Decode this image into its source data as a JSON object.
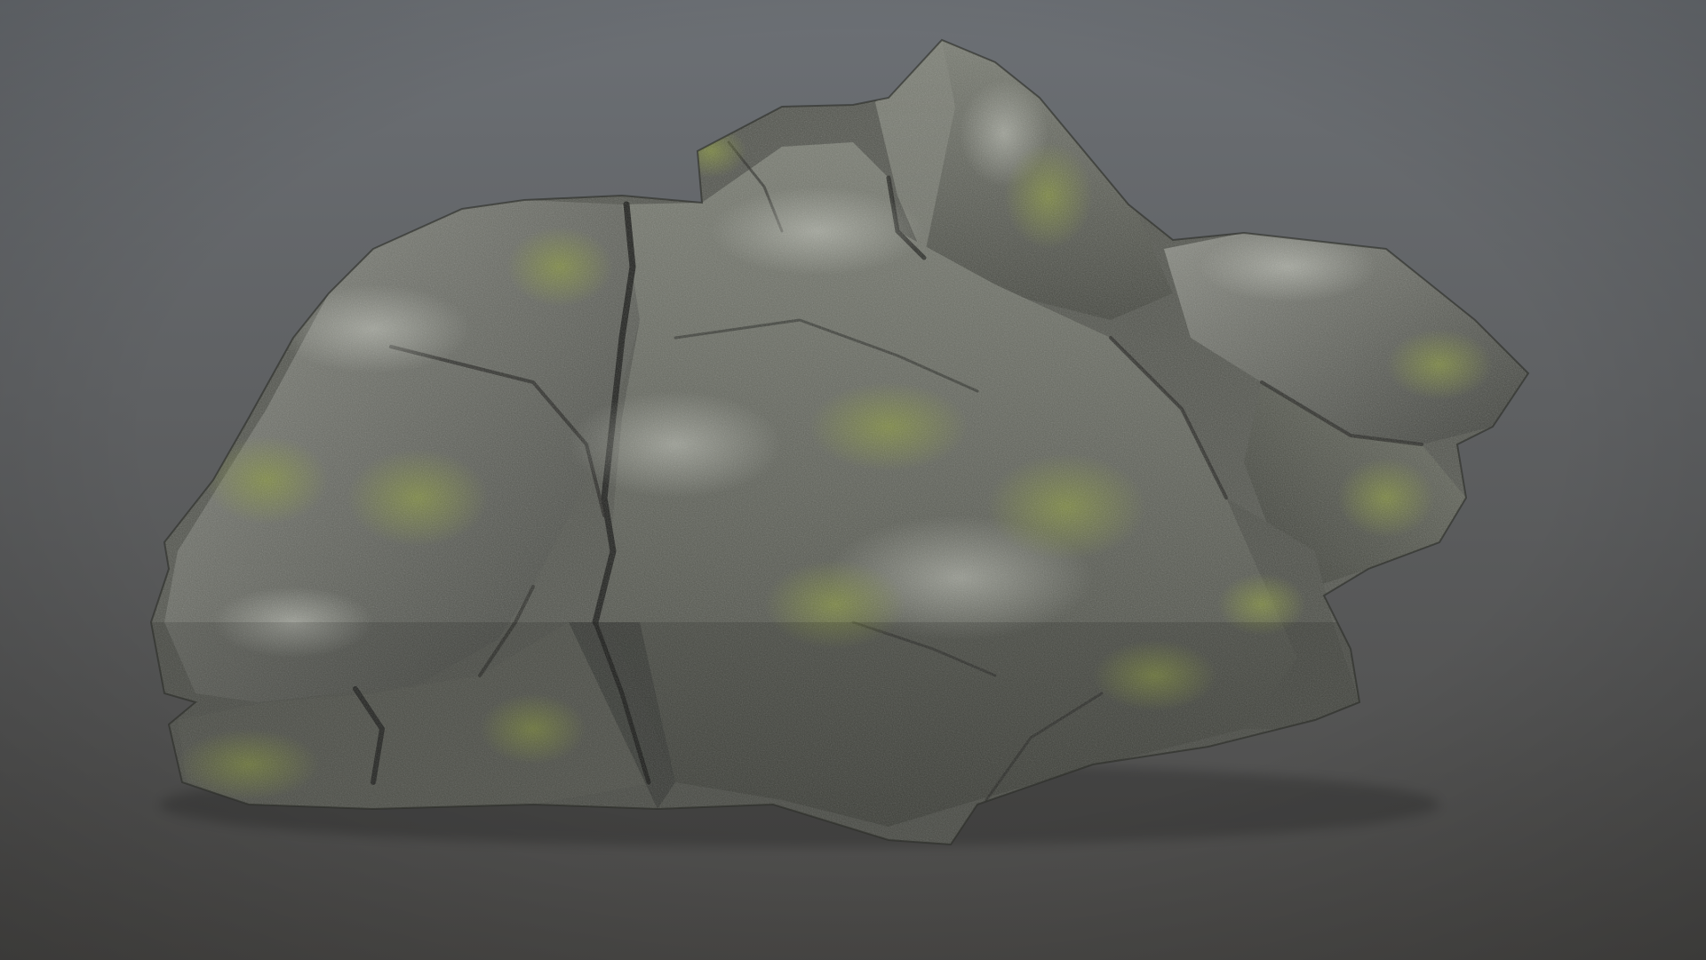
{
  "scene": {
    "subject": "rock-asset",
    "colors": {
      "background_top": "#6c7075",
      "background_bottom": "#4b4a48",
      "rock_base": "#5e605a",
      "rock_light": "#9a9c93",
      "rock_dark": "#2e302c",
      "moss": "#7d8a3a",
      "moss_dark": "#5c6a2a"
    }
  }
}
